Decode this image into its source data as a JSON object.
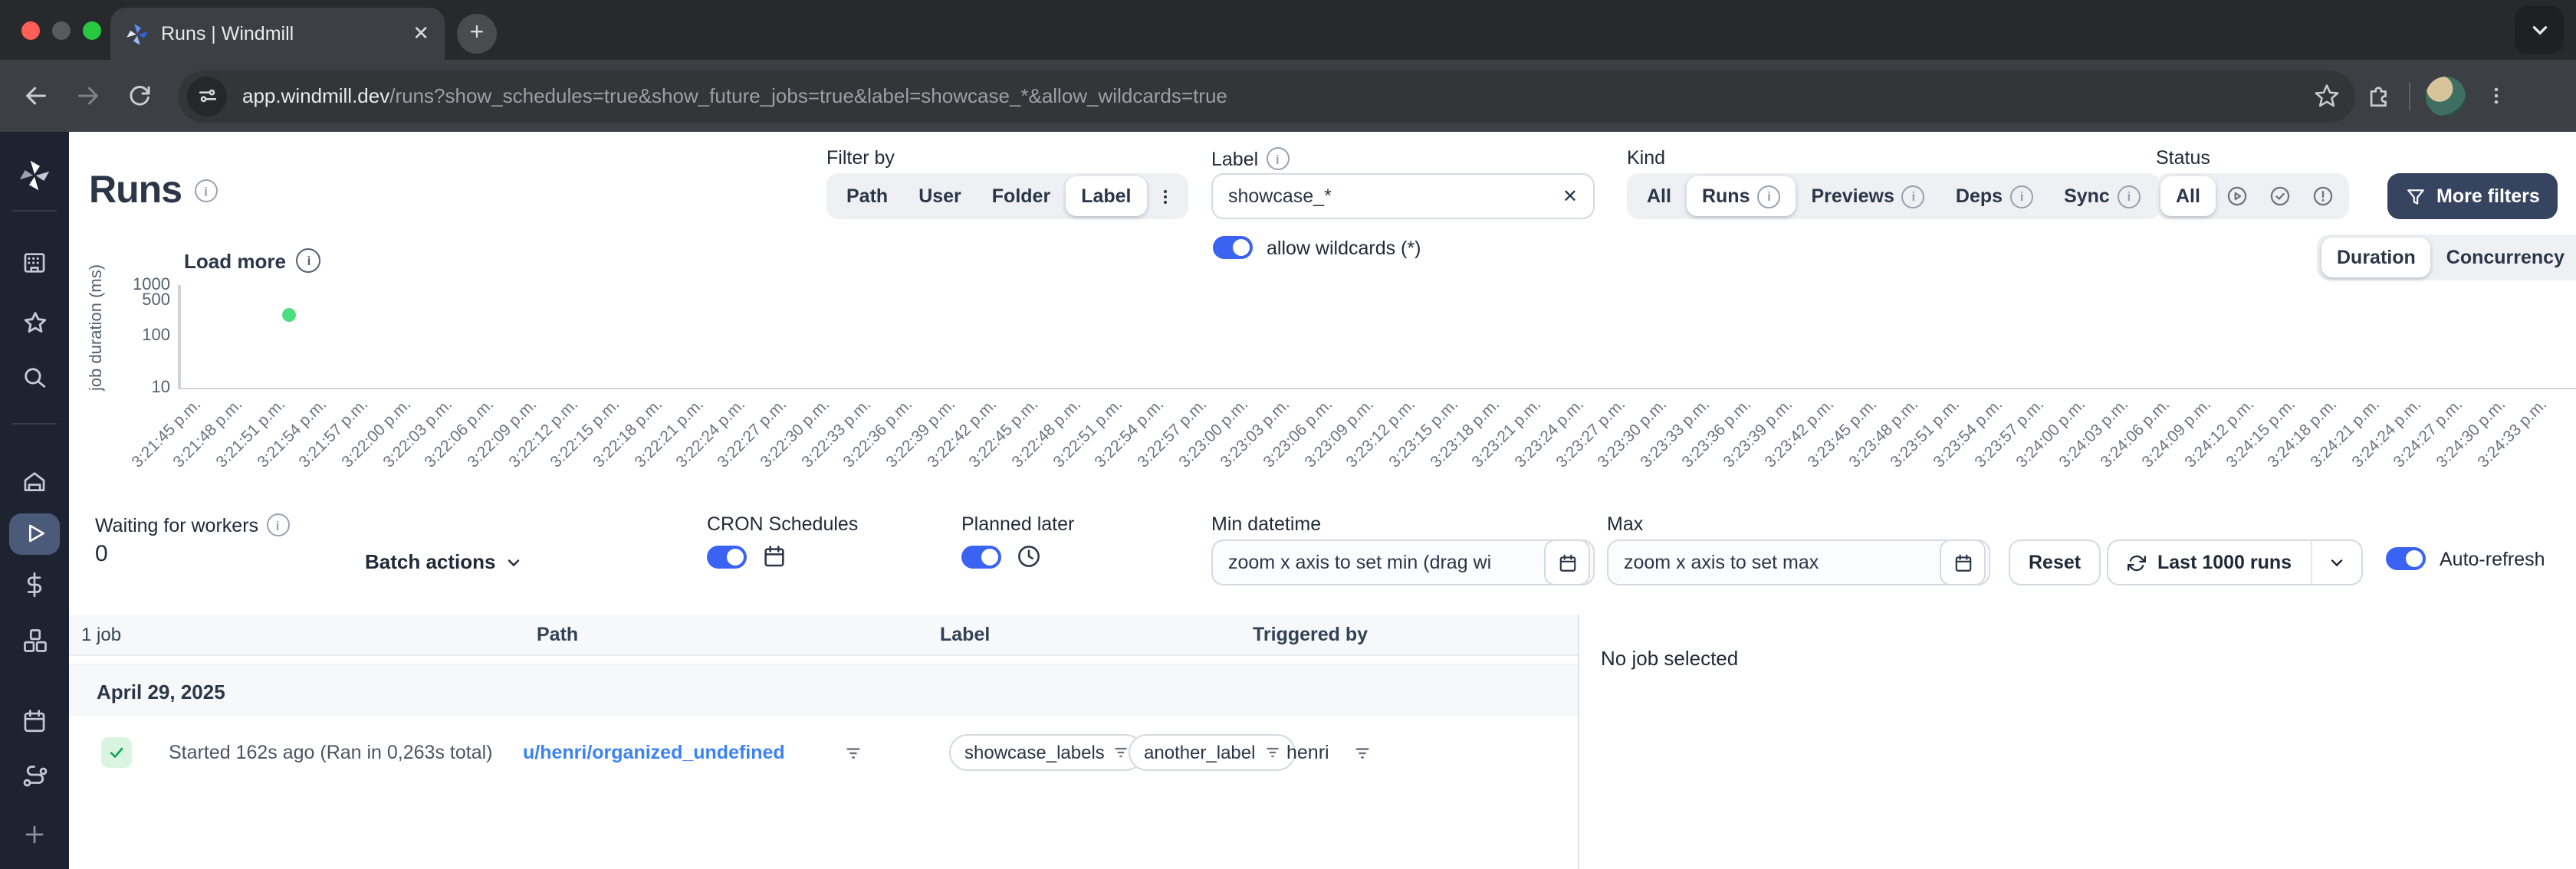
{
  "browser": {
    "tab_title": "Runs | Windmill",
    "url_domain": "app.windmill.dev",
    "url_path": "/runs?show_schedules=true&show_future_jobs=true&label=showcase_*&allow_wildcards=true"
  },
  "header": {
    "title": "Runs"
  },
  "filter_by": {
    "label": "Filter by",
    "options": [
      "Path",
      "User",
      "Folder",
      "Label"
    ],
    "active": "Label"
  },
  "label_filter": {
    "label": "Label",
    "value": "showcase_*",
    "clear_icon": "x",
    "wildcards_label": "allow wildcards (*)",
    "wildcards_on": true
  },
  "kind": {
    "label": "Kind",
    "options": [
      "All",
      "Runs",
      "Previews",
      "Deps",
      "Sync"
    ],
    "active": "Runs"
  },
  "status": {
    "label": "Status",
    "all_label": "All",
    "icon_options": [
      "running-status",
      "success-status",
      "failure-status"
    ],
    "active": "All"
  },
  "more_filters_label": "More filters",
  "view_toggle": {
    "options": [
      "Duration",
      "Concurrency"
    ],
    "active": "Duration"
  },
  "chart_data": {
    "type": "scatter",
    "title": "",
    "ylabel": "job duration (ms)",
    "yscale": "log",
    "yticks": [
      10,
      100,
      500,
      1000
    ],
    "ylim": [
      10,
      1000
    ],
    "load_more_label": "Load more",
    "x_ticks": [
      "3:21:45 p.m.",
      "3:21:48 p.m.",
      "3:21:51 p.m.",
      "3:21:54 p.m.",
      "3:21:57 p.m.",
      "3:22:00 p.m.",
      "3:22:03 p.m.",
      "3:22:06 p.m.",
      "3:22:09 p.m.",
      "3:22:12 p.m.",
      "3:22:15 p.m.",
      "3:22:18 p.m.",
      "3:22:21 p.m.",
      "3:22:24 p.m.",
      "3:22:27 p.m.",
      "3:22:30 p.m.",
      "3:22:33 p.m.",
      "3:22:36 p.m.",
      "3:22:39 p.m.",
      "3:22:42 p.m.",
      "3:22:45 p.m.",
      "3:22:48 p.m.",
      "3:22:51 p.m.",
      "3:22:54 p.m.",
      "3:22:57 p.m.",
      "3:23:00 p.m.",
      "3:23:03 p.m.",
      "3:23:06 p.m.",
      "3:23:09 p.m.",
      "3:23:12 p.m.",
      "3:23:15 p.m.",
      "3:23:18 p.m.",
      "3:23:21 p.m.",
      "3:23:24 p.m.",
      "3:23:27 p.m.",
      "3:23:30 p.m.",
      "3:23:33 p.m.",
      "3:23:36 p.m.",
      "3:23:39 p.m.",
      "3:23:42 p.m.",
      "3:23:45 p.m.",
      "3:23:48 p.m.",
      "3:23:51 p.m.",
      "3:23:54 p.m.",
      "3:23:57 p.m.",
      "3:24:00 p.m.",
      "3:24:03 p.m.",
      "3:24:06 p.m.",
      "3:24:09 p.m.",
      "3:24:12 p.m.",
      "3:24:15 p.m.",
      "3:24:18 p.m.",
      "3:24:21 p.m.",
      "3:24:24 p.m.",
      "3:24:27 p.m.",
      "3:24:30 p.m.",
      "3:24:33 p.m."
    ],
    "points": [
      {
        "x": "3:21:52 p.m.",
        "y_ms": 263,
        "status": "success"
      }
    ],
    "grid": false,
    "legend": "none"
  },
  "controls": {
    "waiting": {
      "label": "Waiting for workers",
      "count": "0"
    },
    "batch_actions_label": "Batch actions",
    "cron_label": "CRON Schedules",
    "planned_label": "Planned later",
    "min_datetime": {
      "label": "Min datetime",
      "placeholder": "zoom x axis to set min (drag wi"
    },
    "max_datetime": {
      "label": "Max",
      "placeholder": "zoom x axis to set max"
    },
    "reset_label": "Reset",
    "last_runs_label": "Last 1000 runs",
    "auto_refresh_label": "Auto-refresh",
    "auto_refresh_on": true
  },
  "table": {
    "count_label": "1 job",
    "columns": [
      "Path",
      "Label",
      "Triggered by"
    ],
    "date_group": "April 29, 2025",
    "rows": [
      {
        "status": "success",
        "started": "Started 162s ago (Ran in 0,263s total)",
        "path": "u/henri/organized_undefined",
        "labels": [
          "showcase_labels",
          "another_label"
        ],
        "triggered_by": "henri"
      }
    ]
  },
  "detail_panel": {
    "empty_label": "No job selected"
  },
  "colors": {
    "accent_blue": "#3b63f3",
    "link_blue": "#3b82f6",
    "success_green": "#4ade80",
    "success_badge_bg": "#d9f5e2",
    "success_check": "#16a34a",
    "dark_button": "#364460",
    "sidebar_bg": "#1d2330",
    "sidebar_active": "#4c5a7a"
  }
}
